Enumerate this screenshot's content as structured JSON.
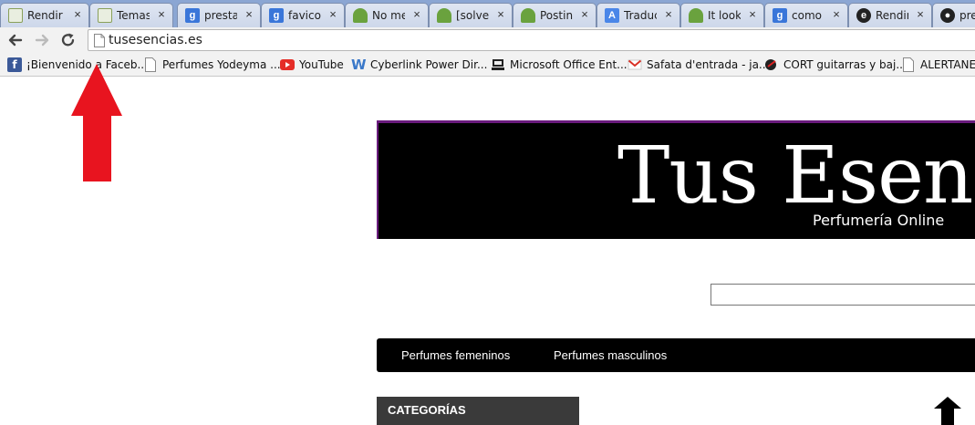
{
  "tabs": [
    {
      "title": "Rendir",
      "icon": "document-icon",
      "color": "#8aa05a"
    },
    {
      "title": "Temas",
      "icon": "document-icon",
      "color": "#8aa05a"
    },
    {
      "title": "presta",
      "icon": "google-icon",
      "color": "#3a76d9"
    },
    {
      "title": "favicon",
      "icon": "google-icon",
      "color": "#3a76d9"
    },
    {
      "title": "No me",
      "icon": "forum-icon",
      "color": "#6aa23e"
    },
    {
      "title": "[solve",
      "icon": "forum-icon",
      "color": "#6aa23e"
    },
    {
      "title": "Postin",
      "icon": "forum-icon",
      "color": "#6aa23e"
    },
    {
      "title": "Traduc",
      "icon": "translate-icon",
      "color": "#4a86e8"
    },
    {
      "title": "It look",
      "icon": "forum-icon",
      "color": "#6aa23e"
    },
    {
      "title": "como",
      "icon": "google-icon",
      "color": "#3a76d9"
    },
    {
      "title": "Rendir",
      "icon": "page-e-icon",
      "color": "#222222"
    },
    {
      "title": "pre",
      "icon": "github-icon",
      "color": "#222222"
    }
  ],
  "tab_close_glyph": "×",
  "toolbar": {
    "url": "tusesencias.es"
  },
  "bookmarks": [
    {
      "label": "¡Bienvenido a Faceb...",
      "icon": "facebook-icon"
    },
    {
      "label": "Perfumes Yodeyma ...",
      "icon": "page-icon"
    },
    {
      "label": "YouTube",
      "icon": "youtube-icon"
    },
    {
      "label": "Cyberlink Power Dir...",
      "icon": "cyberlink-icon"
    },
    {
      "label": "Microsoft Office Ent...",
      "icon": "office-icon"
    },
    {
      "label": "Safata d'entrada - ja...",
      "icon": "gmail-icon"
    },
    {
      "label": "CORT guitarras y baj...",
      "icon": "cort-icon"
    },
    {
      "label": "ALERTANET",
      "icon": "page-icon"
    }
  ],
  "site": {
    "logo_text": "Tus Esenc",
    "tagline": "Perfumería Online",
    "menu": [
      "Perfumes femeninos",
      "Perfumes masculinos"
    ],
    "categories_title": "CATEGORÍAS"
  },
  "colors": {
    "banner_border": "#6a1b7d",
    "annotation_arrow": "#e8141f"
  }
}
